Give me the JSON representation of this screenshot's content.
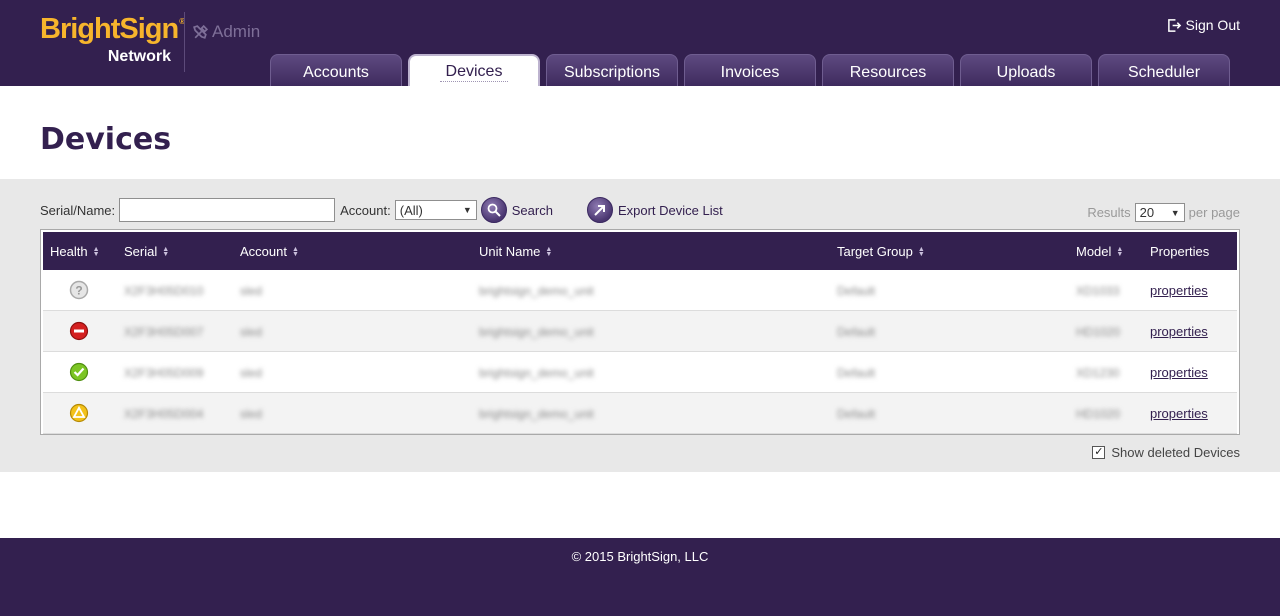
{
  "brand": {
    "name": "BrightSign",
    "registered": "®",
    "sub": "Network",
    "section": "Admin"
  },
  "header": {
    "signout_label": "Sign Out"
  },
  "tabs": [
    {
      "label": "Accounts",
      "active": false
    },
    {
      "label": "Devices",
      "active": true
    },
    {
      "label": "Subscriptions",
      "active": false
    },
    {
      "label": "Invoices",
      "active": false
    },
    {
      "label": "Resources",
      "active": false
    },
    {
      "label": "Uploads",
      "active": false
    },
    {
      "label": "Scheduler",
      "active": false
    }
  ],
  "page": {
    "title": "Devices"
  },
  "filters": {
    "serial_label": "Serial/Name:",
    "serial_value": "",
    "account_label": "Account:",
    "account_value": "(All)",
    "search_label": "Search",
    "export_label": "Export Device List"
  },
  "results": {
    "label": "Results",
    "value": "20",
    "suffix": "per page"
  },
  "table": {
    "columns": [
      "Health",
      "Serial",
      "Account",
      "Unit Name",
      "Target Group",
      "Model",
      "Properties"
    ],
    "rows": [
      {
        "health": "unknown",
        "serial": "X2F3H05D010",
        "account": "sled",
        "unit_name": "brightsign_demo_unit",
        "target_group": "Default",
        "model": "XD1033",
        "properties": "properties"
      },
      {
        "health": "error",
        "serial": "X2F3H05D007",
        "account": "sled",
        "unit_name": "brightsign_demo_unit",
        "target_group": "Default",
        "model": "HD1020",
        "properties": "properties"
      },
      {
        "health": "ok",
        "serial": "X2F3H05D009",
        "account": "sled",
        "unit_name": "brightsign_demo_unit",
        "target_group": "Default",
        "model": "XD1230",
        "properties": "properties"
      },
      {
        "health": "warning",
        "serial": "X2F3H05D004",
        "account": "sled",
        "unit_name": "brightsign_demo_unit",
        "target_group": "Default",
        "model": "HD1020",
        "properties": "properties"
      }
    ]
  },
  "show_deleted": {
    "label": "Show deleted Devices",
    "checked": true,
    "mark": "✓"
  },
  "footer": {
    "copyright": "© 2015 BrightSign, LLC"
  },
  "colors": {
    "brand_purple": "#33204f",
    "logo_orange": "#f7b52c",
    "panel_gray": "#e8e8e8"
  }
}
